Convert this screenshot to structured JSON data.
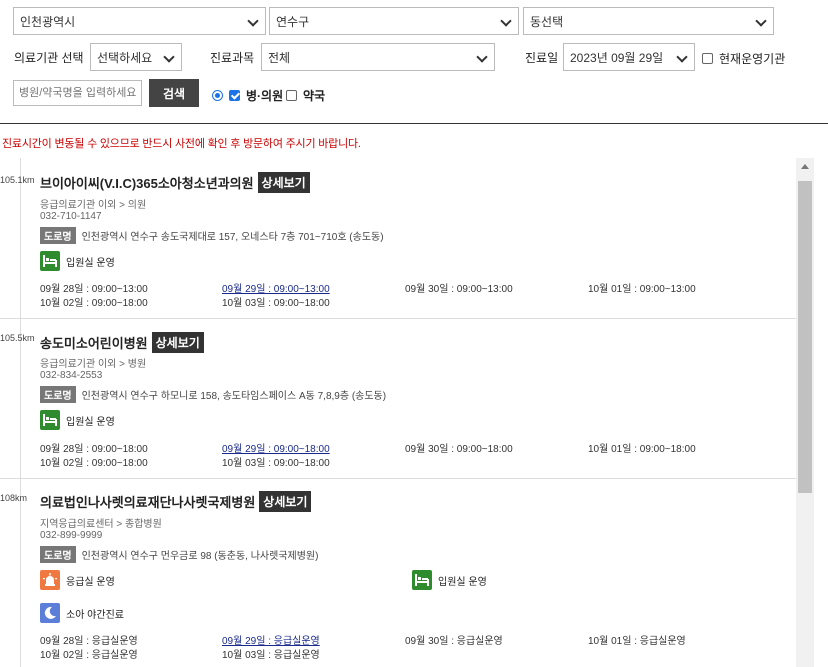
{
  "filters": {
    "region_city": "인천광역시",
    "region_district": "연수구",
    "region_dong": "동선택",
    "facility_label": "의료기관 선택",
    "facility_value": "선택하세요",
    "department_label": "진료과목",
    "department_value": "전체",
    "date_label": "진료일",
    "date_value": "2023년 09월 29일",
    "operating_label": "현재운영기관",
    "search_placeholder": "병원/약국명을 입력하세요",
    "search_button": "검색",
    "hospital_option": "병·의원",
    "pharmacy_option": "약국"
  },
  "notice": "진료시간이 변동될 수 있으므로 반드시 사전에 확인 후 방문하여 주시기 바랍니다.",
  "detail_label": "상세보기",
  "road_badge": "도로명",
  "colors": {
    "accent": "#1a73e8",
    "notice": "#cc0000",
    "ward_icon": "#2e8b2e",
    "er_icon": "#f07841",
    "night_icon": "#5b7fd8"
  },
  "results": [
    {
      "distance": "105.1km",
      "name": "브이아이씨(V.I.C)365소아청소년과의원",
      "type": "응급의료기관 이외 > 의원",
      "phone": "032-710-1147",
      "address": "인천광역시 연수구 송도국제대로 157, 오네스타 7층 701~710호 (송도동)",
      "services": [
        {
          "icon": "bed-icon",
          "label": "입원실 운영"
        }
      ],
      "hours": [
        "09월 28일 : 09:00~13:00",
        "09월 29일 : 09:00~13:00",
        "09월 30일 : 09:00~13:00",
        "10월 01일 : 09:00~13:00",
        "10월 02일 : 09:00~18:00",
        "10월 03일 : 09:00~18:00"
      ]
    },
    {
      "distance": "105.5km",
      "name": "송도미소어린이병원",
      "type": "응급의료기관 이외 > 병원",
      "phone": "032-834-2553",
      "address": "인천광역시 연수구 하모니로 158, 송도타임스페이스 A동 7,8,9층 (송도동)",
      "services": [
        {
          "icon": "bed-icon",
          "label": "입원실 운영"
        }
      ],
      "hours": [
        "09월 28일 : 09:00~18:00",
        "09월 29일 : 09:00~18:00",
        "09월 30일 : 09:00~18:00",
        "10월 01일 : 09:00~18:00",
        "10월 02일 : 09:00~18:00",
        "10월 03일 : 09:00~18:00"
      ]
    },
    {
      "distance": "108km",
      "name": "의료법인나사렛의료재단나사렛국제병원",
      "type": "지역응급의료센터 > 종합병원",
      "phone": "032-899-9999",
      "address": "인천광역시 연수구 먼우금로 98 (동춘동, 나사렛국제병원)",
      "services": [
        {
          "icon": "siren-icon",
          "label": "응급실 운영"
        },
        {
          "icon": "bed-icon",
          "label": "입원실 운영"
        },
        {
          "icon": "moon-icon",
          "label": "소아 야간진료"
        }
      ],
      "hours": [
        "09월 28일 : 응급실운영",
        "09월 29일 : 응급실운영",
        "09월 30일 : 응급실운영",
        "10월 01일 : 응급실운영",
        "10월 02일 : 응급실운영",
        "10월 03일 : 응급실운영"
      ]
    }
  ]
}
